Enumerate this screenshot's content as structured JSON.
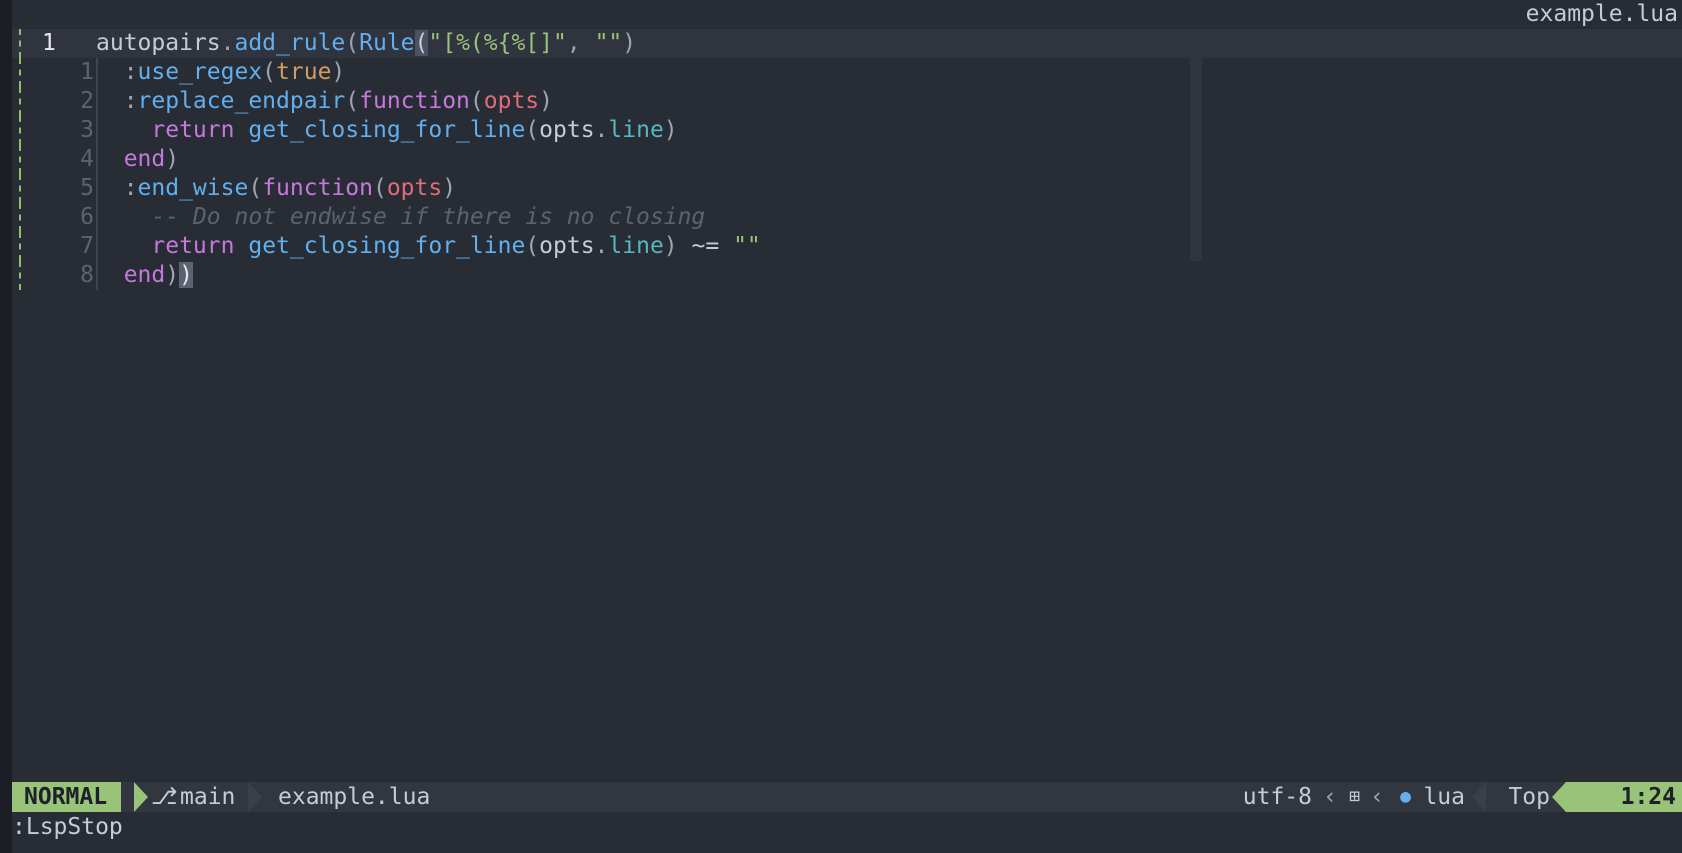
{
  "winbar": {
    "filename": "example.lua"
  },
  "editor": {
    "current_line_number": "1",
    "relative_numbers": [
      "1",
      "2",
      "3",
      "4",
      "5",
      "6",
      "7",
      "8"
    ],
    "lines": [
      [
        {
          "t": "autopairs",
          "c": "plain"
        },
        {
          "t": ".",
          "c": "punc"
        },
        {
          "t": "add_rule",
          "c": "fn"
        },
        {
          "t": "(",
          "c": "punc"
        },
        {
          "t": "Rule",
          "c": "fn"
        },
        {
          "t": "(",
          "c": "cursor-bracket"
        },
        {
          "t": "\"[%(%{%[]\"",
          "c": "str"
        },
        {
          "t": ", ",
          "c": "punc"
        },
        {
          "t": "\"\"",
          "c": "str"
        },
        {
          "t": ")",
          "c": "punc"
        }
      ],
      [
        {
          "t": "  :",
          "c": "punc"
        },
        {
          "t": "use_regex",
          "c": "fn"
        },
        {
          "t": "(",
          "c": "punc"
        },
        {
          "t": "true",
          "c": "bool"
        },
        {
          "t": ")",
          "c": "punc"
        }
      ],
      [
        {
          "t": "  :",
          "c": "punc"
        },
        {
          "t": "replace_endpair",
          "c": "fn"
        },
        {
          "t": "(",
          "c": "punc"
        },
        {
          "t": "function",
          "c": "kw"
        },
        {
          "t": "(",
          "c": "punc"
        },
        {
          "t": "opts",
          "c": "param"
        },
        {
          "t": ")",
          "c": "punc"
        }
      ],
      [
        {
          "t": "    ",
          "c": "plain"
        },
        {
          "t": "return",
          "c": "kw"
        },
        {
          "t": " ",
          "c": "plain"
        },
        {
          "t": "get_closing_for_line",
          "c": "fn"
        },
        {
          "t": "(",
          "c": "punc"
        },
        {
          "t": "opts",
          "c": "plain"
        },
        {
          "t": ".",
          "c": "punc"
        },
        {
          "t": "line",
          "c": "field"
        },
        {
          "t": ")",
          "c": "punc"
        }
      ],
      [
        {
          "t": "  ",
          "c": "plain"
        },
        {
          "t": "end",
          "c": "kw"
        },
        {
          "t": ")",
          "c": "punc"
        }
      ],
      [
        {
          "t": "  :",
          "c": "punc"
        },
        {
          "t": "end_wise",
          "c": "fn"
        },
        {
          "t": "(",
          "c": "punc"
        },
        {
          "t": "function",
          "c": "kw"
        },
        {
          "t": "(",
          "c": "punc"
        },
        {
          "t": "opts",
          "c": "param"
        },
        {
          "t": ")",
          "c": "punc"
        }
      ],
      [
        {
          "t": "    ",
          "c": "plain"
        },
        {
          "t": "-- Do not endwise if there is no closing",
          "c": "cmt"
        }
      ],
      [
        {
          "t": "    ",
          "c": "plain"
        },
        {
          "t": "return",
          "c": "kw"
        },
        {
          "t": " ",
          "c": "plain"
        },
        {
          "t": "get_closing_for_line",
          "c": "fn"
        },
        {
          "t": "(",
          "c": "punc"
        },
        {
          "t": "opts",
          "c": "plain"
        },
        {
          "t": ".",
          "c": "punc"
        },
        {
          "t": "line",
          "c": "field"
        },
        {
          "t": ") ",
          "c": "punc"
        },
        {
          "t": "~=",
          "c": "plain"
        },
        {
          "t": " ",
          "c": "plain"
        },
        {
          "t": "\"\"",
          "c": "str"
        }
      ],
      [
        {
          "t": "  ",
          "c": "plain"
        },
        {
          "t": "end",
          "c": "kw"
        },
        {
          "t": ")",
          "c": "punc"
        },
        {
          "t": ")",
          "c": "cursor"
        }
      ]
    ]
  },
  "statusline": {
    "mode": "NORMAL",
    "branch_icon": "git-branch-icon",
    "branch": "main",
    "filename": "example.lua",
    "encoding": "utf-8",
    "os_icon": "windows-icon",
    "filetype_icon": "lua-icon",
    "filetype": "lua",
    "position": "Top",
    "line_col": "1:24"
  },
  "cmdline": {
    "text": ":LspStop"
  },
  "colors": {
    "background": "#282c34",
    "mode_normal": "#98c379",
    "keyword": "#c678dd",
    "function": "#61afef",
    "string": "#98c379",
    "comment": "#5c6370"
  }
}
